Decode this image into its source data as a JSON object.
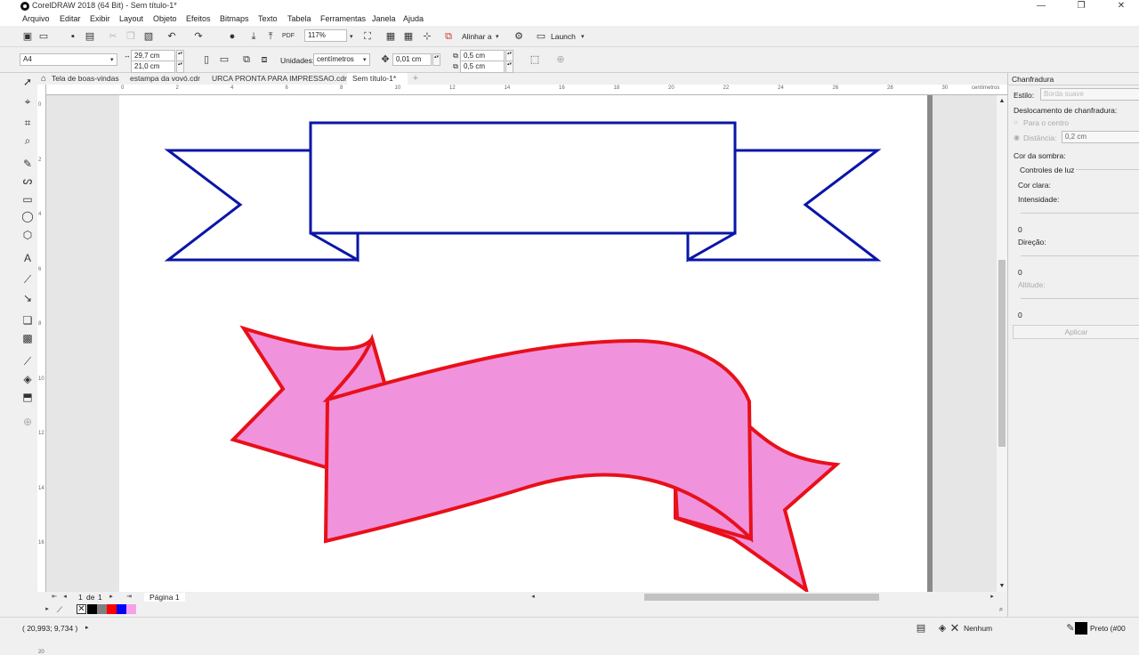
{
  "window": {
    "title": "CorelDRAW 2018 (64 Bit) - Sem título-1*",
    "minimize": "—",
    "maximize": "❐",
    "close": "✕"
  },
  "menu": [
    "Arquivo",
    "Editar",
    "Exibir",
    "Layout",
    "Objeto",
    "Efeitos",
    "Bitmaps",
    "Texto",
    "Tabela",
    "Ferramentas",
    "Janela",
    "Ajuda"
  ],
  "toolbar": {
    "zoom": "117%",
    "align": "Alinhar a",
    "launch": "Launch"
  },
  "propbar": {
    "page_size": "A4",
    "width": "29,7 cm",
    "height": "21,0 cm",
    "units_label": "Unidades:",
    "units": "centímetros",
    "nudge": "0,01 cm",
    "dup_x": "0,5 cm",
    "dup_y": "0,5 cm"
  },
  "tabs": [
    "Tela de boas-vindas",
    "estampa da vovó.cdr",
    "URCA PRONTA PARA IMPRESSAO.cdr*",
    "Sem título-1*"
  ],
  "ruler": {
    "unit": "centímetros",
    "h_ticks": [
      "0",
      "2",
      "4",
      "6",
      "8",
      "10",
      "12",
      "14",
      "16",
      "18",
      "20",
      "22",
      "24",
      "26",
      "28",
      "30"
    ],
    "v_ticks": [
      "0",
      "2",
      "4",
      "6",
      "8",
      "10",
      "12",
      "14",
      "16",
      "18",
      "20"
    ]
  },
  "page_nav": {
    "current": "1",
    "of_label": "de",
    "total": "1",
    "page_tab": "Página 1"
  },
  "palette_colors": [
    "#ffffff",
    "#000000",
    "#808080",
    "#ff0000",
    "#0000ff",
    "#f5a0e8"
  ],
  "status": {
    "coords": "( 20,993; 9,734 )",
    "fill": "Nenhum",
    "outline": "Preto (#00"
  },
  "docker": {
    "title": "Chanfradura",
    "style_label": "Estilo:",
    "style_value": "Borda suave",
    "offset_label": "Deslocamento de chanfradura:",
    "to_center": "Para o centro",
    "distance_label": "Distância:",
    "distance_value": "0,2 cm",
    "shadow_color": "Cor da sombra:",
    "light_controls": "Controles de luz",
    "light_color": "Cor clara:",
    "intensity": "Intensidade:",
    "intensity_val": "0",
    "direction": "Direção:",
    "direction_val": "0",
    "altitude": "Altitude:",
    "altitude_val": "0",
    "apply": "Aplicar"
  },
  "colors": {
    "blue_ribbon_stroke": "#0a15a8",
    "pink_fill": "#f093dc",
    "red_stroke": "#e8101a"
  }
}
